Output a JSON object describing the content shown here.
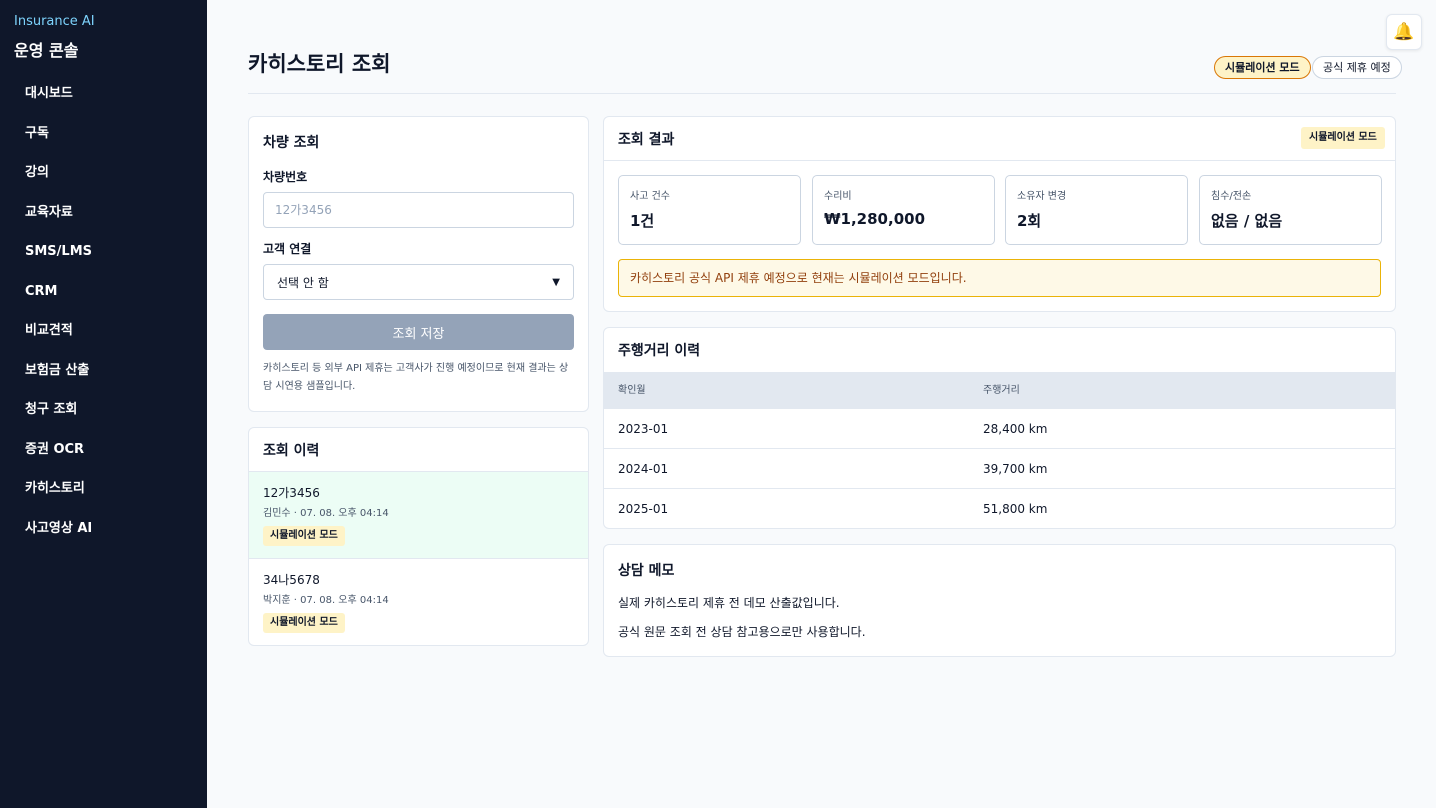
{
  "sidebar": {
    "brand_small": "Insurance AI",
    "brand_title": "운영 콘솔",
    "items": [
      {
        "label": "대시보드"
      },
      {
        "label": "구독"
      },
      {
        "label": "강의"
      },
      {
        "label": "교육자료"
      },
      {
        "label": "SMS/LMS"
      },
      {
        "label": "CRM"
      },
      {
        "label": "비교견적"
      },
      {
        "label": "보험금 산출"
      },
      {
        "label": "청구 조회"
      },
      {
        "label": "증권 OCR"
      },
      {
        "label": "카히스토리"
      },
      {
        "label": "사고영상 AI"
      }
    ]
  },
  "header": {
    "title": "카히스토리 조회",
    "badge_simulation": "시뮬레이션 모드",
    "badge_official": "공식 제휴 예정",
    "bell_icon": "bell-icon"
  },
  "lookup": {
    "title": "차량 조회",
    "plate_label": "차량번호",
    "plate_placeholder": "12가3456",
    "customer_label": "고객 연결",
    "customer_selected": "선택 안 함",
    "save_label": "조회 저장",
    "note": "카히스토리 등 외부 API 제휴는 고객사가 진행 예정이므로 현재 결과는 상담 시연용 샘플입니다."
  },
  "history": {
    "title": "조회 이력",
    "items": [
      {
        "plate": "12가3456",
        "meta": "김민수 · 07. 08. 오후 04:14",
        "badge": "시뮬레이션 모드"
      },
      {
        "plate": "34나5678",
        "meta": "박지훈 · 07. 08. 오후 04:14",
        "badge": "시뮬레이션 모드"
      }
    ]
  },
  "result": {
    "title": "조회 결과",
    "badge": "시뮬레이션 모드",
    "stats": [
      {
        "label": "사고 건수",
        "value": "1건"
      },
      {
        "label": "수리비",
        "value": "₩1,280,000"
      },
      {
        "label": "소유자 변경",
        "value": "2회"
      },
      {
        "label": "침수/전손",
        "value": "없음 / 없음"
      }
    ],
    "alert": "카히스토리 공식 API 제휴 예정으로 현재는 시뮬레이션 모드입니다."
  },
  "mileage": {
    "title": "주행거리 이력",
    "col_date": "확인월",
    "col_km": "주행거리",
    "rows": [
      {
        "date": "2023-01",
        "km": "28,400 km"
      },
      {
        "date": "2024-01",
        "km": "39,700 km"
      },
      {
        "date": "2025-01",
        "km": "51,800 km"
      }
    ]
  },
  "memo": {
    "title": "상담 메모",
    "lines": [
      "실제 카히스토리 제휴 전 데모 산출값입니다.",
      "공식 원문 조회 전 상담 참고용으로만 사용합니다."
    ]
  }
}
